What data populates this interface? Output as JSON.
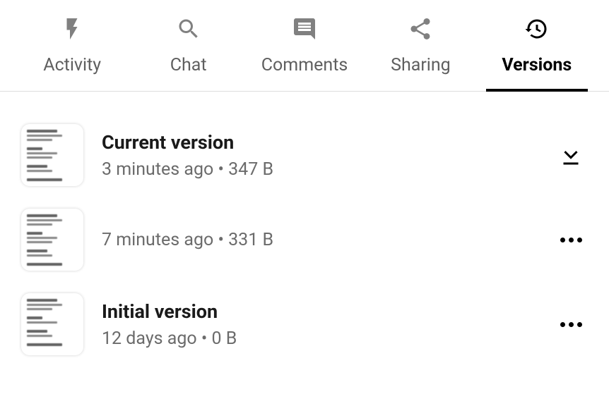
{
  "tabs": [
    {
      "id": "activity",
      "label": "Activity",
      "icon": "bolt",
      "active": false
    },
    {
      "id": "chat",
      "label": "Chat",
      "icon": "search",
      "active": false
    },
    {
      "id": "comments",
      "label": "Comments",
      "icon": "comment",
      "active": false
    },
    {
      "id": "sharing",
      "label": "Sharing",
      "icon": "share",
      "active": false
    },
    {
      "id": "versions",
      "label": "Versions",
      "icon": "history",
      "active": true
    }
  ],
  "versions": [
    {
      "title": "Current version",
      "time": "3 minutes ago",
      "size": "347 B",
      "action": "download"
    },
    {
      "title": "",
      "time": "7 minutes ago",
      "size": "331 B",
      "action": "more"
    },
    {
      "title": "Initial version",
      "time": "12 days ago",
      "size": "0 B",
      "action": "more"
    }
  ],
  "meta_separator": "  •  "
}
